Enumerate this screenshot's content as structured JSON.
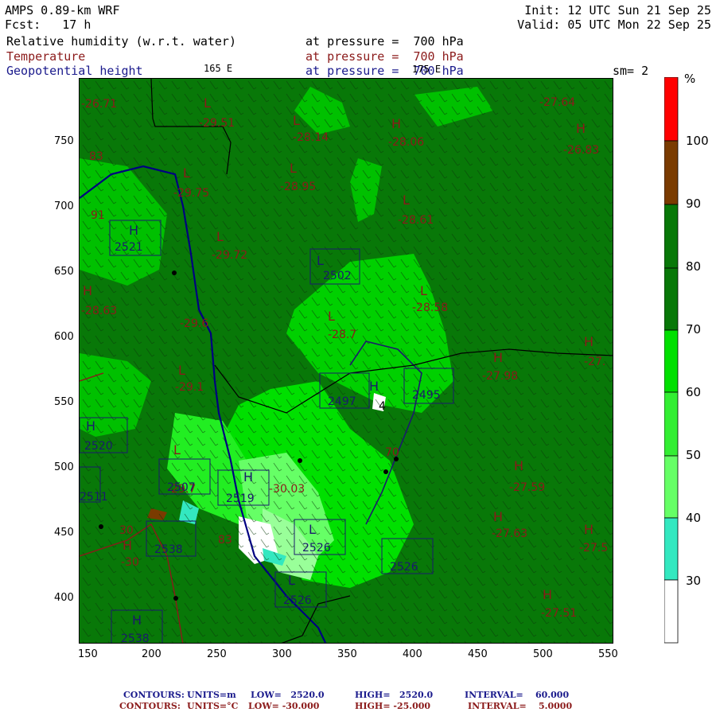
{
  "header": {
    "model": "AMPS 0.89-km WRF",
    "fcst": "Fcst:   17 h",
    "init": "Init: 12 UTC Sun 21 Sep 25",
    "valid": "Valid: 05 UTC Mon 22 Sep 25",
    "field1": "Relative humidity (w.r.t. water)",
    "field2": "Temperature",
    "field3": "Geopotential height",
    "pressure1": "at pressure =  700 hPa",
    "pressure2": "at pressure =  700 hPa",
    "pressure3": "at pressure =  700 hPa",
    "lon165": "165 E",
    "lon175": "175 E",
    "smoothing": "sm= 2"
  },
  "colors": {
    "background_green": "#087808",
    "rh_90_100": "#7a3b00",
    "rh_100": "#ff0000",
    "rh_70_80": "#00e000",
    "rh_60_70": "#33ee33",
    "rh_50_60": "#66ff66",
    "rh_40_50": "#99ff99",
    "rh_30_40": "#33e8c0",
    "rh_below_30": "#ffffff",
    "temperature_contour": "#8b1a1a",
    "height_contour": "#1a1a8c",
    "coastline": "#000080"
  },
  "axes": {
    "x_ticks": [
      "150",
      "200",
      "250",
      "300",
      "350",
      "400",
      "450",
      "500",
      "550"
    ],
    "y_ticks": [
      "750",
      "700",
      "650",
      "600",
      "550",
      "500",
      "450",
      "400"
    ]
  },
  "colorbar": {
    "unit": "%",
    "labels": [
      "100",
      "90",
      "80",
      "70",
      "60",
      "50",
      "40",
      "30"
    ],
    "levels": [
      {
        "range": "90-100",
        "color": "#ff0000"
      },
      {
        "range": "80-90",
        "color": "#7a3b00"
      },
      {
        "range": "70-80",
        "color": "#087808"
      },
      {
        "range": "60-70",
        "color": "#087808"
      },
      {
        "range": "50-60",
        "color": "#00e000"
      },
      {
        "range": "40-50",
        "color": "#33ee33"
      },
      {
        "range": "30-40",
        "color": "#66ff66"
      },
      {
        "range": "20-30",
        "color": "#99ff99"
      },
      {
        "range": "10-20",
        "color": "#33e8c0"
      },
      {
        "range": "0-10",
        "color": "#ffffff"
      }
    ]
  },
  "map_labels": {
    "temps": [
      "-26.71",
      "-27.64",
      "-29.51",
      "-28.14",
      "-28.06",
      "-26.83",
      "-29.75",
      "-28.95",
      "-28.61",
      "-29.72",
      "-28.58",
      "-28.63",
      "-29.6",
      "-28.7",
      "-29.1",
      "-27.98",
      "-27.",
      "-29.7",
      "-27.59",
      "-27.63",
      "-27.5",
      "-30.03",
      "-30",
      "-27.51"
    ],
    "heights": [
      "2521",
      "2502",
      "2497",
      "2495",
      "2520",
      "2507",
      "2519",
      "2511",
      "2538",
      "2526",
      "2526",
      "2526",
      "2538"
    ],
    "misc_numbers": [
      "83",
      "91",
      "4",
      "70",
      "83",
      "30"
    ],
    "highs": [
      "H",
      "H",
      "H",
      "H",
      "H",
      "H",
      "H",
      "H",
      "H",
      "H",
      "H",
      "H",
      "H",
      "H",
      "H"
    ],
    "lows": [
      "L",
      "L",
      "L",
      "L",
      "L",
      "L",
      "L",
      "L",
      "L",
      "L",
      "L",
      "L",
      "L"
    ]
  },
  "footer": {
    "line1_label": "CONTOURS:",
    "line1_units": "UNITS=m",
    "line1_low": "LOW=   2520.0",
    "line1_high": "HIGH=   2520.0",
    "line1_interval": "INTERVAL=    60.000",
    "line2_label": "CONTOURS:",
    "line2_units": "UNITS=°C",
    "line2_low": "LOW= -30.000",
    "line2_high": "HIGH= -25.000",
    "line2_interval": "INTERVAL=    5.0000"
  }
}
